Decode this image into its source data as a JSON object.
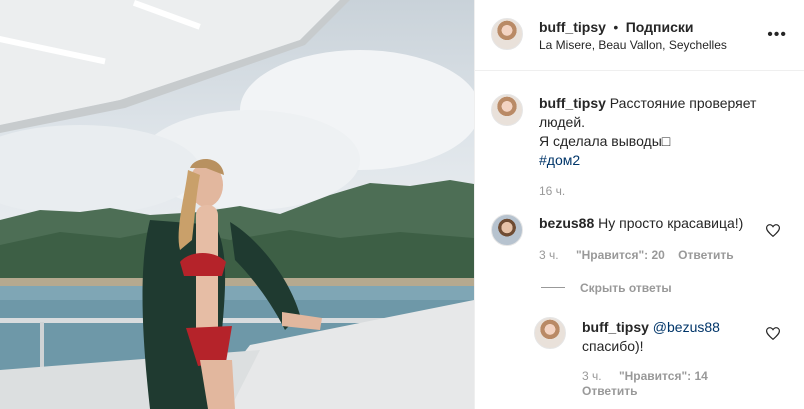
{
  "post": {
    "username": "buff_tipsy",
    "separator": "•",
    "follow_label": "Подписки",
    "location": "La Misere, Beau Vallon, Seychelles",
    "more_icon": "more-horizontal-icon"
  },
  "caption": {
    "username": "buff_tipsy",
    "line1": "Расстояние проверяет",
    "line2": "людей.",
    "line3": "Я сделала выводы",
    "line3_symbol": "□",
    "hashtag": "#дом2",
    "time": "16 ч."
  },
  "comments": [
    {
      "username": "bezus88",
      "text": "Ну просто красавица!)",
      "time": "3 ч.",
      "likes": "\"Нравится\": 20",
      "reply_label": "Ответить"
    }
  ],
  "hide_replies_label": "Скрыть ответы",
  "reply": {
    "username": "buff_tipsy",
    "mention": "@bezus88",
    "text": "спасибо)!",
    "time": "3 ч.",
    "likes": "\"Нравится\": 14",
    "reply_label": "Ответить"
  },
  "colors": {
    "link": "#003569",
    "muted": "#999999",
    "text": "#262626",
    "border": "#efefef"
  }
}
